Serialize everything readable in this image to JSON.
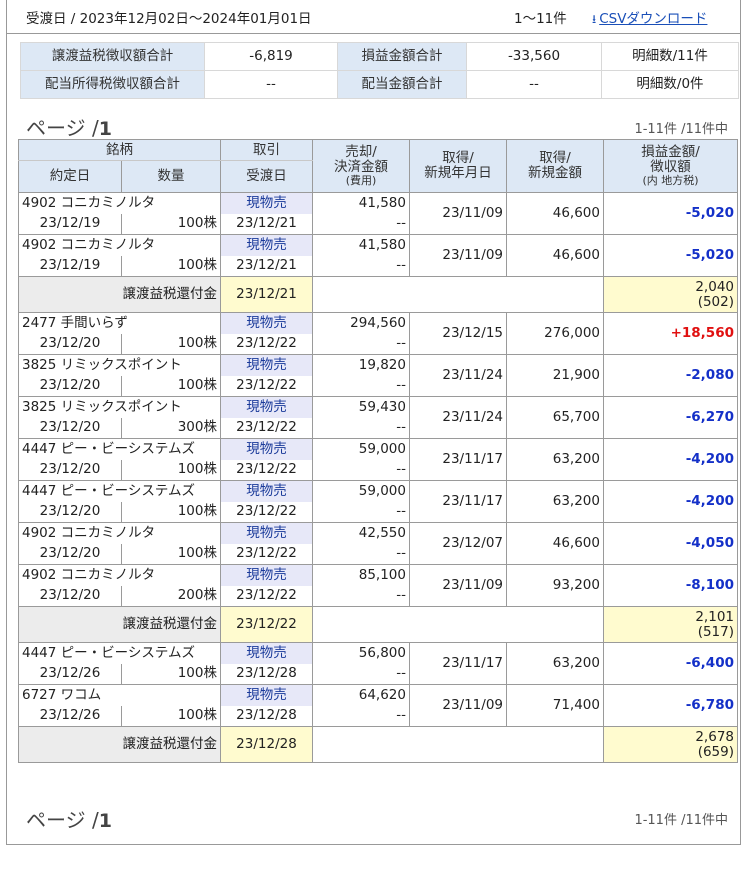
{
  "header": {
    "period": "受渡日 / 2023年12月02日〜2024年01月01日",
    "range": "1〜11件",
    "csv_label": "CSVダウンロード"
  },
  "summary": [
    {
      "label1": "譲渡益税徴収額合計",
      "value1": "-6,819",
      "label2": "損益金額合計",
      "value2": "-33,560",
      "count": "明細数/11件"
    },
    {
      "label1": "配当所得税徴収額合計",
      "value1": "--",
      "label2": "配当金額合計",
      "value2": "--",
      "count": "明細数/0件"
    }
  ],
  "pager": {
    "label": "ページ /",
    "page": "1",
    "count": "1-11件 /11件中"
  },
  "columns": {
    "brand": "銘柄",
    "trade": "取引",
    "sell": "売却/",
    "settle": "決済金額",
    "fees": "(費用)",
    "acq_date1": "取得/",
    "acq_date2": "新規年月日",
    "acq_amt1": "取得/",
    "acq_amt2": "新規金額",
    "pl1": "損益金額/",
    "pl2": "徴収額",
    "pl3": "(内 地方税)",
    "contract_date": "約定日",
    "qty": "数量",
    "delivery_date": "受渡日"
  },
  "rows": [
    {
      "name": "4902 コニカミノルタ",
      "trade": "現物売",
      "sell": "41,580",
      "fee": "--",
      "date": "23/12/19",
      "qty": "100株",
      "delivery": "23/12/21",
      "acq_date": "23/11/09",
      "acq_amt": "46,600",
      "pl": "-5,020",
      "sign": "neg"
    },
    {
      "name": "4902 コニカミノルタ",
      "trade": "現物売",
      "sell": "41,580",
      "fee": "--",
      "date": "23/12/19",
      "qty": "100株",
      "delivery": "23/12/21",
      "acq_date": "23/11/09",
      "acq_amt": "46,600",
      "pl": "-5,020",
      "sign": "neg"
    },
    {
      "refund": true,
      "label": "譲渡益税還付金",
      "delivery": "23/12/21",
      "amount": "2,040",
      "local": "(502)"
    },
    {
      "name": "2477 手間いらず",
      "trade": "現物売",
      "sell": "294,560",
      "fee": "--",
      "date": "23/12/20",
      "qty": "100株",
      "delivery": "23/12/22",
      "acq_date": "23/12/15",
      "acq_amt": "276,000",
      "pl": "+18,560",
      "sign": "pos"
    },
    {
      "name": "3825 リミックスポイント",
      "trade": "現物売",
      "sell": "19,820",
      "fee": "--",
      "date": "23/12/20",
      "qty": "100株",
      "delivery": "23/12/22",
      "acq_date": "23/11/24",
      "acq_amt": "21,900",
      "pl": "-2,080",
      "sign": "neg"
    },
    {
      "name": "3825 リミックスポイント",
      "trade": "現物売",
      "sell": "59,430",
      "fee": "--",
      "date": "23/12/20",
      "qty": "300株",
      "delivery": "23/12/22",
      "acq_date": "23/11/24",
      "acq_amt": "65,700",
      "pl": "-6,270",
      "sign": "neg"
    },
    {
      "name": "4447 ピー・ビーシステムズ",
      "trade": "現物売",
      "sell": "59,000",
      "fee": "--",
      "date": "23/12/20",
      "qty": "100株",
      "delivery": "23/12/22",
      "acq_date": "23/11/17",
      "acq_amt": "63,200",
      "pl": "-4,200",
      "sign": "neg"
    },
    {
      "name": "4447 ピー・ビーシステムズ",
      "trade": "現物売",
      "sell": "59,000",
      "fee": "--",
      "date": "23/12/20",
      "qty": "100株",
      "delivery": "23/12/22",
      "acq_date": "23/11/17",
      "acq_amt": "63,200",
      "pl": "-4,200",
      "sign": "neg"
    },
    {
      "name": "4902 コニカミノルタ",
      "trade": "現物売",
      "sell": "42,550",
      "fee": "--",
      "date": "23/12/20",
      "qty": "100株",
      "delivery": "23/12/22",
      "acq_date": "23/12/07",
      "acq_amt": "46,600",
      "pl": "-4,050",
      "sign": "neg"
    },
    {
      "name": "4902 コニカミノルタ",
      "trade": "現物売",
      "sell": "85,100",
      "fee": "--",
      "date": "23/12/20",
      "qty": "200株",
      "delivery": "23/12/22",
      "acq_date": "23/11/09",
      "acq_amt": "93,200",
      "pl": "-8,100",
      "sign": "neg"
    },
    {
      "refund": true,
      "label": "譲渡益税還付金",
      "delivery": "23/12/22",
      "amount": "2,101",
      "local": "(517)"
    },
    {
      "name": "4447 ピー・ビーシステムズ",
      "trade": "現物売",
      "sell": "56,800",
      "fee": "--",
      "date": "23/12/26",
      "qty": "100株",
      "delivery": "23/12/28",
      "acq_date": "23/11/17",
      "acq_amt": "63,200",
      "pl": "-6,400",
      "sign": "neg"
    },
    {
      "name": "6727 ワコム",
      "trade": "現物売",
      "sell": "64,620",
      "fee": "--",
      "date": "23/12/26",
      "qty": "100株",
      "delivery": "23/12/28",
      "acq_date": "23/11/09",
      "acq_amt": "71,400",
      "pl": "-6,780",
      "sign": "neg"
    },
    {
      "refund": true,
      "label": "譲渡益税還付金",
      "delivery": "23/12/28",
      "amount": "2,678",
      "local": "(659)"
    }
  ]
}
